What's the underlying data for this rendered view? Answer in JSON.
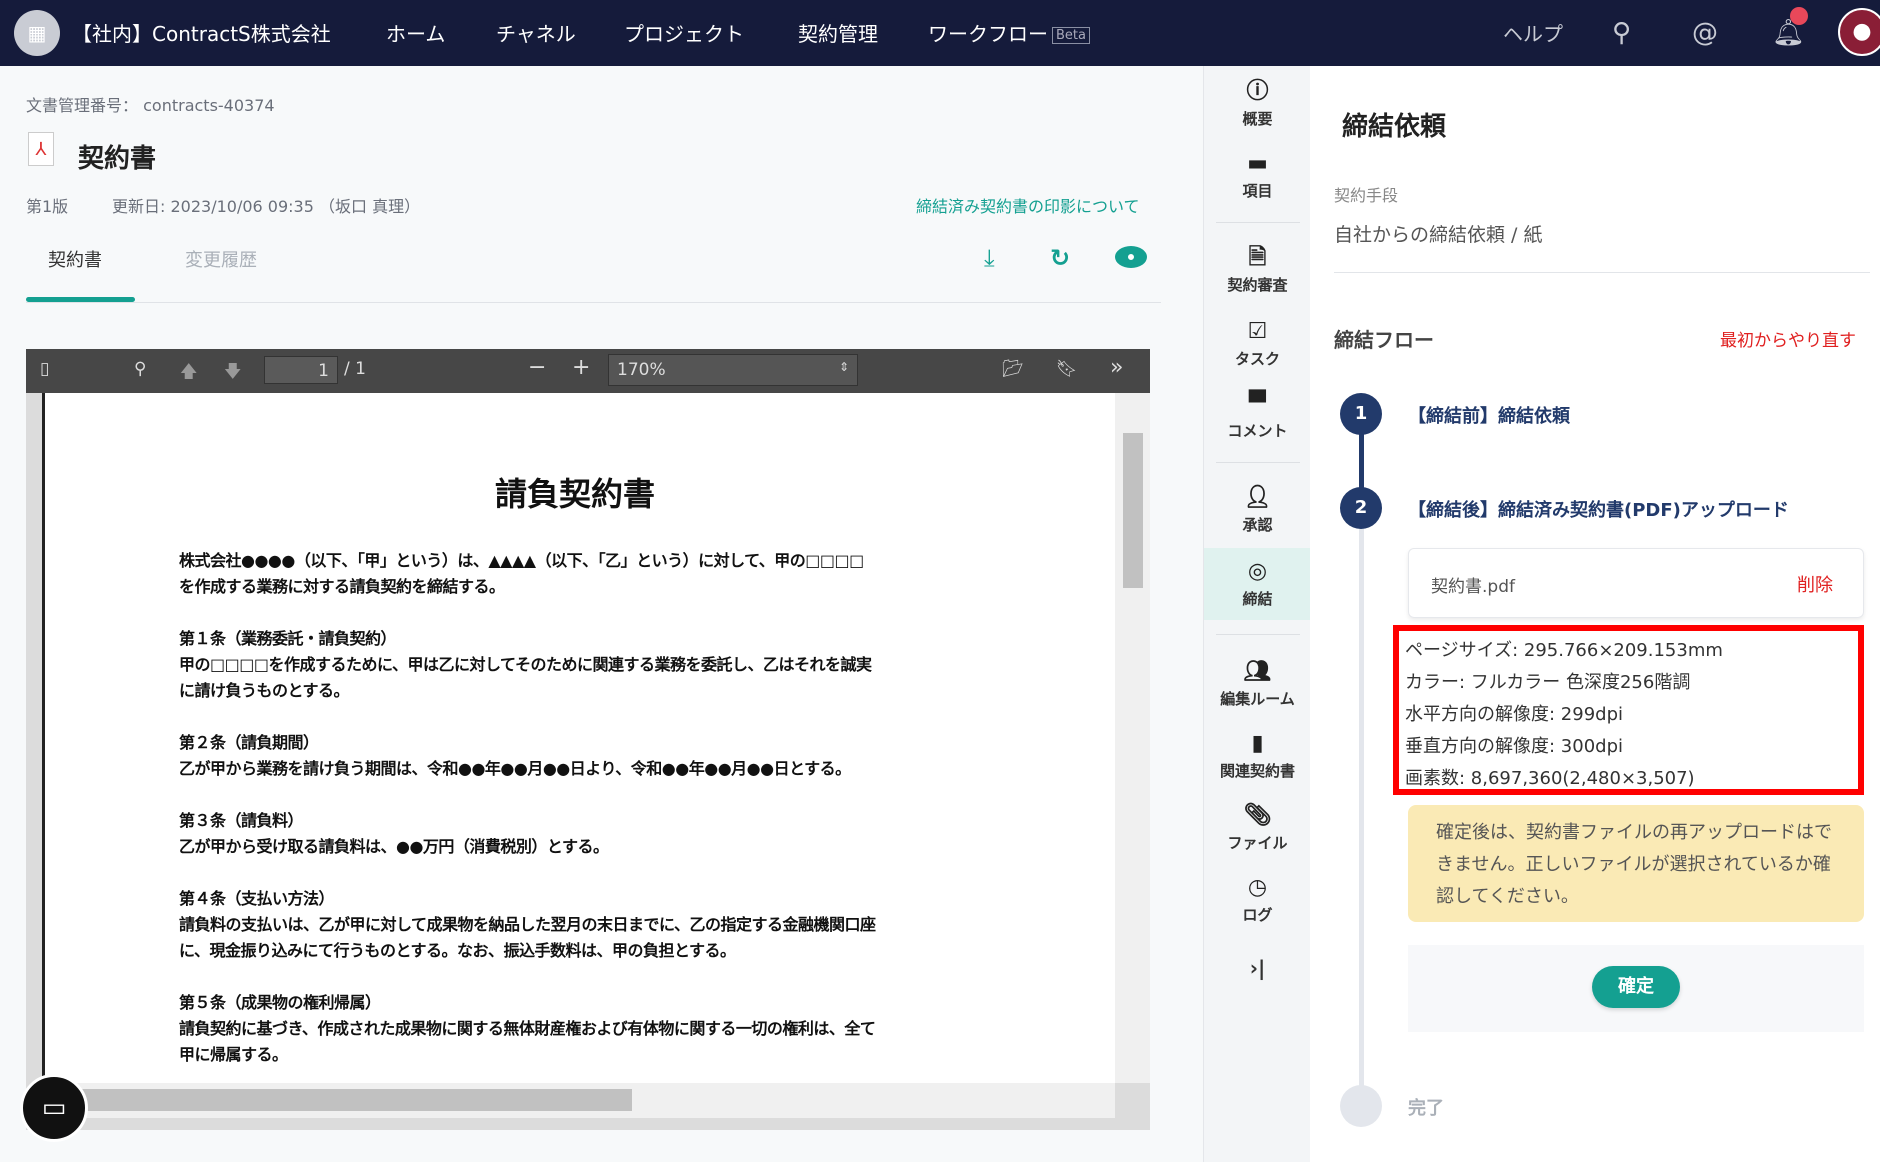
{
  "header": {
    "logo": "▦",
    "org": "【社内】ContractS株式会社",
    "nav": [
      "ホーム",
      "チャネル",
      "プロジェクト",
      "契約管理",
      "ワークフロー"
    ],
    "beta": "Beta",
    "help": "ヘルプ"
  },
  "doc": {
    "number_label": "文書管理番号：",
    "number": "contracts-40374",
    "title": "契約書",
    "version": "第1版",
    "updated": "更新日: 2023/10/06 09:35 （坂口 真理）",
    "seal_link": "締結済み契約書の印影について",
    "tabs": [
      "契約書",
      "変更履歴"
    ]
  },
  "viewer": {
    "page": "1",
    "total": "/ 1",
    "zoom": "170%"
  },
  "pdf": {
    "title": "請負契約書",
    "lines": [
      "株式会社●●●●（以下、「甲」という）は、▲▲▲▲（以下、「乙」という）に対して、甲の□□□□",
      "を作成する業務に対する請負契約を締結する。",
      "第１条（業務委託・請負契約）",
      "甲の□□□□を作成するために、甲は乙に対してそのために関連する業務を委託し、乙はそれを誠実",
      "に請け負うものとする。",
      "第２条（請負期間）",
      "乙が甲から業務を請け負う期間は、令和●●年●●月●●日より、令和●●年●●月●●日とする。",
      "第３条（請負料）",
      "乙が甲から受け取る請負料は、●●万円（消費税別）とする。",
      "第４条（支払い方法）",
      "請負料の支払いは、乙が甲に対して成果物を納品した翌月の末日までに、乙の指定する金融機関口座",
      "に、現金振り込みにて行うものとする。なお、振込手数料は、甲の負担とする。",
      "第５条（成果物の権利帰属）",
      "請負契約に基づき、作成された成果物に関する無体財産権および有体物に関する一切の権利は、全て",
      "甲に帰属する。"
    ]
  },
  "sidebar": [
    "概要",
    "項目",
    "契約審査",
    "タスク",
    "コメント",
    "承認",
    "締結",
    "編集ルーム",
    "関連契約書",
    "ファイル",
    "ログ"
  ],
  "panel": {
    "title": "締結依頼",
    "method_label": "契約手段",
    "method": "自社からの締結依頼 / 紙",
    "flow_title": "締結フロー",
    "restart": "最初からやり直す",
    "steps": [
      {
        "num": "1",
        "label": "【締結前】締結依頼"
      },
      {
        "num": "2",
        "label": "【締結後】締結済み契約書(PDF)アップロード"
      }
    ],
    "file": "契約書.pdf",
    "delete": "削除",
    "info": [
      "ページサイズ: 295.766×209.153mm",
      "カラー: フルカラー 色深度256階調",
      "水平方向の解像度: 299dpi",
      "垂直方向の解像度: 300dpi",
      "画素数: 8,697,360(2,480×3,507)"
    ],
    "warning": "確定後は、契約書ファイルの再アップロードはできません。正しいファイルが選択されているか確認してください。",
    "confirm": "確定",
    "done": "完了"
  },
  "colors": {
    "navy": "#151b3b",
    "teal": "#14a091",
    "red": "#e02020"
  }
}
